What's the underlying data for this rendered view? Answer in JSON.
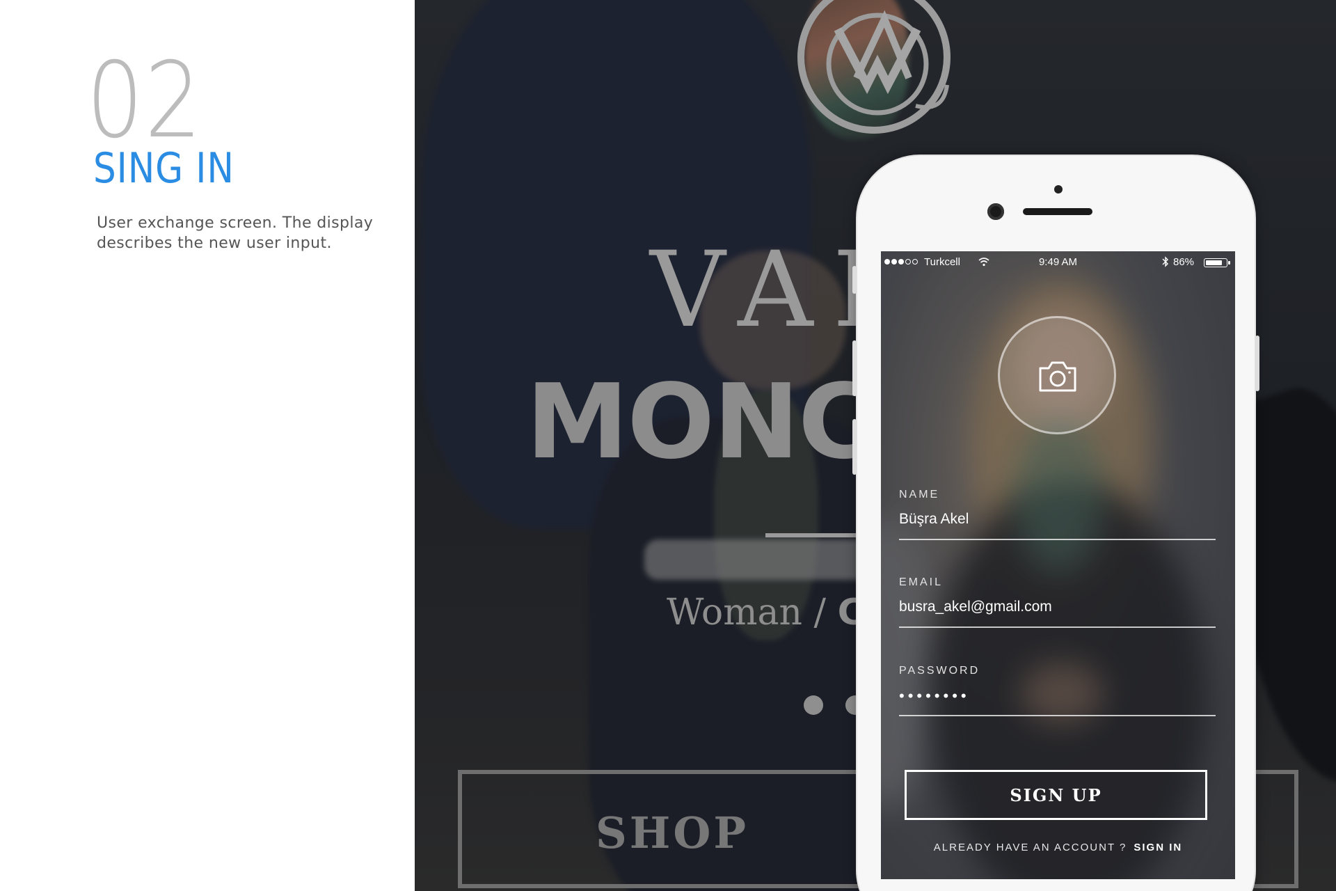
{
  "left_panel": {
    "step_number": "02",
    "title": "SING IN",
    "description": "User exchange screen. The display describes the new user input."
  },
  "background": {
    "brand_text": "VAL",
    "headline": "MONC",
    "subtitle_serif": "Woman /",
    "subtitle_sans": "C",
    "shop_label": "SHOP"
  },
  "phone": {
    "status_bar": {
      "carrier": "Turkcell",
      "time": "9:49 AM",
      "battery": "86%",
      "battery_level": 0.86,
      "signal_bars_filled": 3,
      "signal_bars_total": 5
    },
    "form": {
      "name_label": "NAME",
      "name_value": "Büşra Akel",
      "email_label": "EMAIL",
      "email_value": "busra_akel@gmail.com",
      "password_label": "PASSWORD",
      "password_value": "••••••••",
      "signup_label": "SIGN UP",
      "already_text": "ALREADY HAVE AN ACCOUNT ?",
      "signin_link": "SIGN IN"
    }
  },
  "colors": {
    "accent_blue": "#2a8ce2",
    "step_number_gray": "#bcbcbc",
    "background_dark": "#1e2126",
    "phone_body": "#f7f7f7"
  },
  "icons": [
    "brand-monogram-icon",
    "wifi-icon",
    "bluetooth-icon",
    "battery-icon",
    "camera-icon"
  ]
}
